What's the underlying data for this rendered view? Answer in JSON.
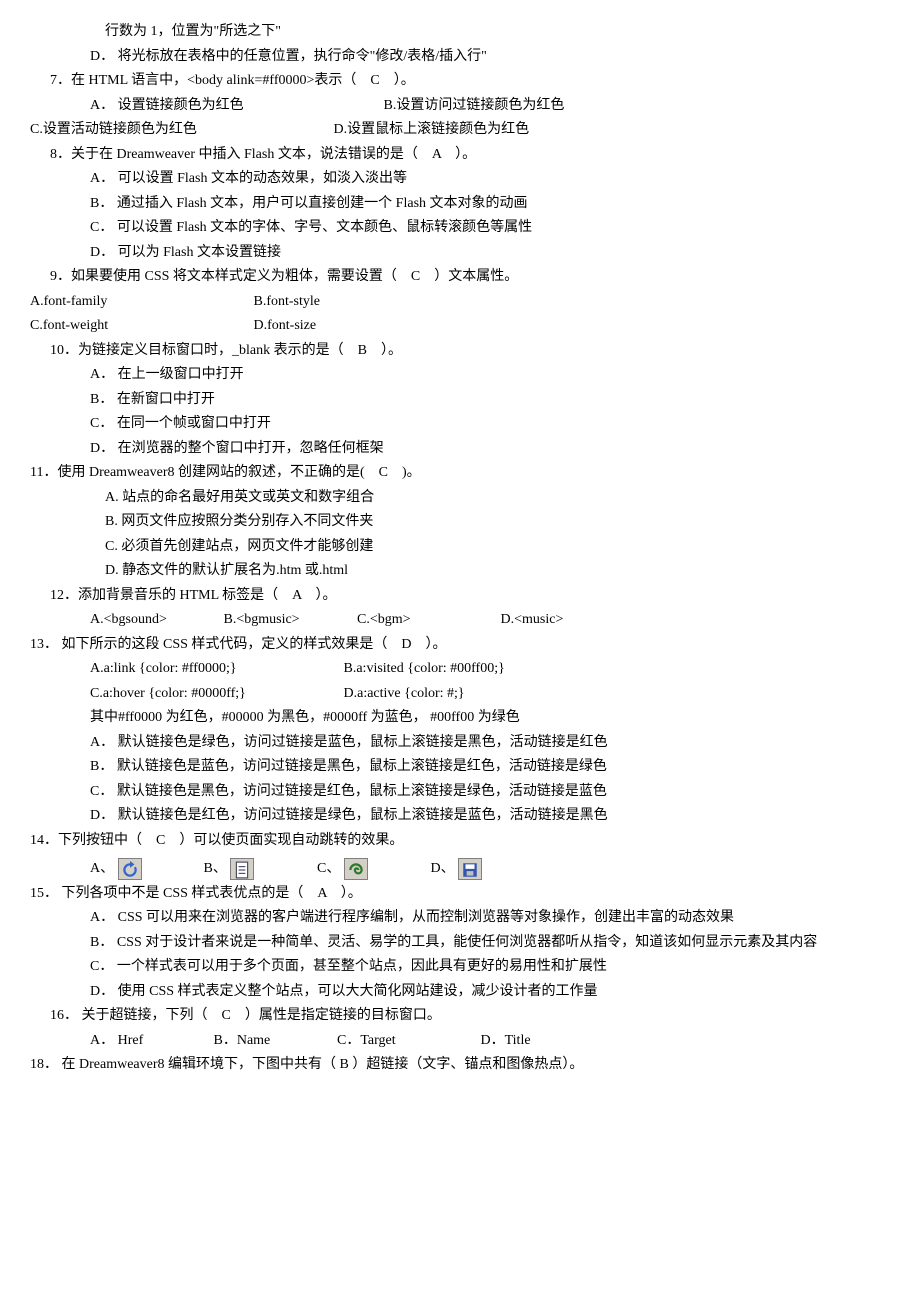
{
  "preline1": "行数为 1，位置为\"所选之下\"",
  "preline2_label": "D．",
  "preline2_text": "将光标放在表格中的任意位置，执行命令\"修改/表格/插入行\"",
  "q7": {
    "stem": "7．在 HTML 语言中，<body alink=#ff0000>表示（　C　）。",
    "A": "A．  设置链接颜色为红色",
    "B": "B.设置访问过链接颜色为红色",
    "C": "C.设置活动链接颜色为红色",
    "D": "D.设置鼠标上滚链接颜色为红色"
  },
  "q8": {
    "stem": "8．关于在 Dreamweaver 中插入 Flash 文本，说法错误的是（　A　）。",
    "A": "A．  可以设置 Flash 文本的动态效果，如淡入淡出等",
    "B": "B．  通过插入 Flash 文本，用户可以直接创建一个 Flash 文本对象的动画",
    "C": "C．  可以设置 Flash 文本的字体、字号、文本颜色、鼠标转滚颜色等属性",
    "D": "D．  可以为 Flash 文本设置链接"
  },
  "q9": {
    "stem": "9．如果要使用 CSS 将文本样式定义为粗体，需要设置（　C　）文本属性。",
    "A": "A.font-family",
    "B": "B.font-style",
    "C": "C.font-weight",
    "D": "D.font-size"
  },
  "q10": {
    "stem": "10．为链接定义目标窗口时，_blank 表示的是（　B　）。",
    "A": "A．  在上一级窗口中打开",
    "B": "B．  在新窗口中打开",
    "C": "C．  在同一个帧或窗口中打开",
    "D": "D．  在浏览器的整个窗口中打开，忽略任何框架"
  },
  "q11": {
    "stem": "11．使用 Dreamweaver8 创建网站的叙述，不正确的是(　C　)。",
    "A": "A. 站点的命名最好用英文或英文和数字组合",
    "B": "B. 网页文件应按照分类分别存入不同文件夹",
    "C": "C. 必须首先创建站点，网页文件才能够创建",
    "D": "D. 静态文件的默认扩展名为.htm 或.html"
  },
  "q12": {
    "stem": "12．添加背景音乐的 HTML 标签是（　A　）。",
    "A": "A.<bgsound>",
    "B": "B.<bgmusic>",
    "C": "C.<bgm>",
    "D": "D.<music>"
  },
  "q13": {
    "stem": "13． 如下所示的这段 CSS 样式代码，定义的样式效果是（　D　）。",
    "code1a": "A.a:link {color: #ff0000;}",
    "code1b": "B.a:visited {color: #00ff00;}",
    "code2a": "C.a:hover {color: #0000ff;}",
    "code2b": "D.a:active {color: #;}",
    "note": "其中#ff0000 为红色，#00000 为黑色，#0000ff 为蓝色， #00ff00 为绿色",
    "A": "A．  默认链接色是绿色，访问过链接是蓝色，鼠标上滚链接是黑色，活动链接是红色",
    "B": "B．  默认链接色是蓝色，访问过链接是黑色，鼠标上滚链接是红色，活动链接是绿色",
    "C": "C．  默认链接色是黑色，访问过链接是红色，鼠标上滚链接是绿色，活动链接是蓝色",
    "D": "D．  默认链接色是红色，访问过链接是绿色，鼠标上滚链接是蓝色，活动链接是黑色"
  },
  "q14": {
    "stem": "14．下列按钮中（　C　）可以使页面实现自动跳转的效果。",
    "A": "A、",
    "B": "B、",
    "C": "C、",
    "D": "D、"
  },
  "q15": {
    "stem": "15． 下列各项中不是 CSS 样式表优点的是（　A　）。",
    "A": "A．  CSS 可以用来在浏览器的客户端进行程序编制，从而控制浏览器等对象操作，创建出丰富的动态效果",
    "B": "B．  CSS 对于设计者来说是一种简单、灵活、易学的工具，能使任何浏览器都听从指令，知道该如何显示元素及其内容",
    "C": "C．  一个样式表可以用于多个页面，甚至整个站点，因此具有更好的易用性和扩展性",
    "D": "D．  使用 CSS 样式表定义整个站点，可以大大简化网站建设，减少设计者的工作量"
  },
  "q16": {
    "stem": "16． 关于超链接，下列（　C　）属性是指定链接的目标窗口。",
    "A": "A．  Href",
    "B": "B．Name",
    "C": "C．Target",
    "D": "D．Title"
  },
  "q18": {
    "stem": "18． 在 Dreamweaver8 编辑环境下，下图中共有（ B ）超链接（文字、锚点和图像热点）。"
  }
}
